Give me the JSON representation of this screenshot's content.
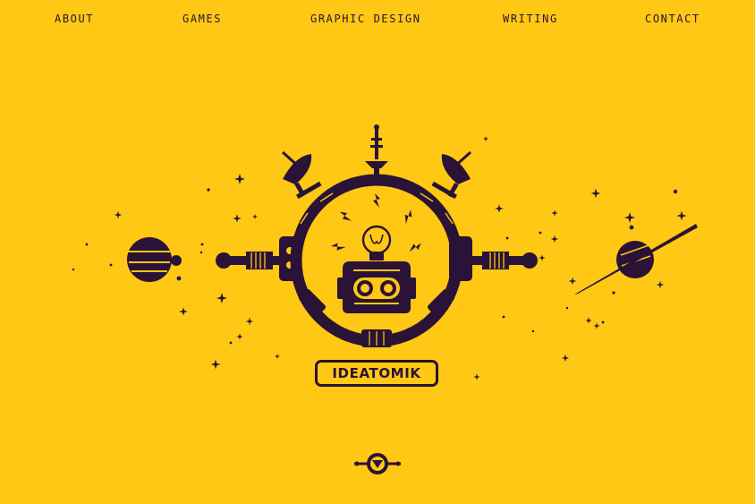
{
  "nav": {
    "about": "ABOUT",
    "games": "GAMES",
    "graphic_design": "GRAPHIC DESIGN",
    "writing": "WRITING",
    "contact": "CONTACT"
  },
  "hero": {
    "logo_text": "IDEATOMIK"
  },
  "icons": {
    "hero_illustration": "robot-space-station-icon",
    "scroll_down": "scroll-down-icon"
  },
  "colors": {
    "background": "#fec814",
    "ink": "#2a1336"
  }
}
